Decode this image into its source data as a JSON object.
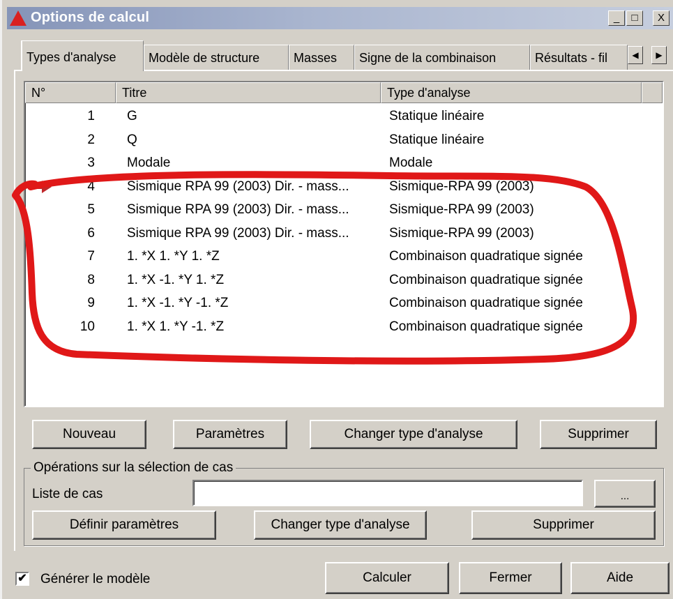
{
  "window": {
    "title": "Options de calcul",
    "controls": {
      "minimize": "_",
      "maximize": "□",
      "close": "X"
    }
  },
  "tabs": [
    {
      "label": "Types d'analyse",
      "active": true
    },
    {
      "label": "Modèle de structure"
    },
    {
      "label": "Masses"
    },
    {
      "label": "Signe de la combinaison"
    },
    {
      "label": "Résultats - fil"
    }
  ],
  "tab_scroll": {
    "left": "◀",
    "right": "▶"
  },
  "list": {
    "columns": [
      "N°",
      "Titre",
      "Type d'analyse"
    ],
    "rows": [
      {
        "num": "1",
        "title": "G",
        "type": "Statique linéaire"
      },
      {
        "num": "2",
        "title": "Q",
        "type": "Statique linéaire"
      },
      {
        "num": "3",
        "title": "Modale",
        "type": "Modale"
      },
      {
        "num": "4",
        "title": "Sismique RPA 99 (2003) Dir. - mass...",
        "type": "Sismique-RPA 99 (2003)",
        "current": true
      },
      {
        "num": "5",
        "title": "Sismique RPA 99 (2003) Dir. - mass...",
        "type": "Sismique-RPA 99 (2003)"
      },
      {
        "num": "6",
        "title": "Sismique RPA 99 (2003) Dir. - mass...",
        "type": "Sismique-RPA 99 (2003)"
      },
      {
        "num": "7",
        "title": "1. *X 1. *Y 1. *Z",
        "type": "Combinaison quadratique signée"
      },
      {
        "num": "8",
        "title": "1. *X -1. *Y 1. *Z",
        "type": "Combinaison quadratique signée"
      },
      {
        "num": "9",
        "title": "1. *X -1. *Y -1. *Z",
        "type": "Combinaison quadratique signée"
      },
      {
        "num": "10",
        "title": "1. *X 1. *Y -1. *Z",
        "type": "Combinaison quadratique signée"
      }
    ]
  },
  "list_buttons": {
    "new": "Nouveau",
    "params": "Paramètres",
    "change_type": "Changer type d'analyse",
    "delete": "Supprimer"
  },
  "selection_group": {
    "label": "Opérations sur la sélection de cas",
    "cases_label": "Liste de cas",
    "cases_value": "",
    "browse": "...",
    "define_params": "Définir paramètres",
    "change_type": "Changer type d'analyse",
    "delete": "Supprimer"
  },
  "footer": {
    "generate_model": "Générer le modèle",
    "generate_checked": true,
    "check_mark": "✔",
    "calculate": "Calculer",
    "close": "Fermer",
    "help": "Aide"
  },
  "colors": {
    "annotation": "#e01818",
    "arrow": "#c0282b",
    "icon": "#d92020"
  }
}
